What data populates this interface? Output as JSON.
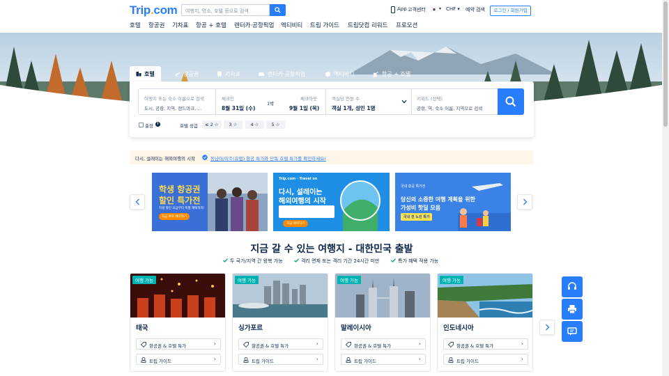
{
  "header": {
    "logo_main": "Trip",
    "logo_dot": ".",
    "logo_suffix": "com",
    "search_placeholder": "여행지, 명소, 호텔 등으로 검색",
    "app_label": "App",
    "support_label": "고객센터",
    "currency_label": "CHF",
    "booking_label": "예약 검색",
    "login_label": "로그인 / 회원가입"
  },
  "nav": [
    "호텔",
    "항공권",
    "기차표",
    "항공 + 호텔",
    "렌터카·공항픽업",
    "액티비티",
    "트립 가이드",
    "트립닷컴 리워드",
    "프로모션"
  ],
  "tabs": [
    {
      "label": "호텔",
      "icon": "hotel-icon",
      "active": true
    },
    {
      "label": "항공권",
      "icon": "airplane-icon"
    },
    {
      "label": "기차표",
      "icon": "train-icon"
    },
    {
      "label": "렌터카·공항픽업",
      "icon": "car-icon"
    },
    {
      "label": "액티비티",
      "icon": "activity-icon"
    },
    {
      "label": "항공 + 호텔",
      "icon": "bundle-icon"
    }
  ],
  "search_form": {
    "destination_label": "여행지 또는 숙소 이름으로 검색",
    "destination_hint": "도시, 공항, 지역, 랜드마크, ...",
    "checkin_label": "체크인",
    "checkin_value": "8월 31일 (수)",
    "nights": "1박",
    "checkout_label": "체크아웃",
    "checkout_value": "9월 1일 (목)",
    "guests_label": "객실당 인원 수",
    "guests_value": "객실 1개, 성인 1명",
    "keyword_label": "키워드 (선택)",
    "keyword_hint": "공항, 역, 숙소 이름, 지역으로 검색",
    "business_label": "출장",
    "star_label": "호텔 성급",
    "star_options": [
      "≤ 2 ☆",
      "3 ☆",
      "4 ☆",
      "5 ☆"
    ]
  },
  "promo": {
    "text": "다시, 설레이는 해외여행의 시작",
    "link": "동남아/미주(유럽) 항공 특가와 단독 호텔 특가를 확인하세요!"
  },
  "banners": [
    {
      "title_1": "학생 항공권",
      "title_2": "할인 특가전",
      "desc": "학생 할인 요금부터 특별 혜택까지!",
      "button": "지금 바로 예약하기"
    },
    {
      "brand": "Trip.com · Travel on",
      "title_1": "다시, 설레이는",
      "title_2": "해외여행의 시작",
      "button": "지금 예약하기"
    },
    {
      "tag": "국내 항공 특가전",
      "title_1": "당신의 소중한 여행 계획을 위한",
      "title_2": "가성비 핫딜 모음",
      "button": "국내 전 노선 특가"
    }
  ],
  "destinations": {
    "title": "지금 갈 수 있는 여행지 - 대한민국 출발",
    "features": [
      "두 국가/지역 간 왕복 가능",
      "격리 면제 또는 격리 기간 24시간 미만",
      "특가 혜택 적용 가능"
    ],
    "badge": "여행 가능",
    "cards": [
      {
        "name": "태국",
        "link1": "항공권 & 호텔 특가",
        "link2": "트립 가이드"
      },
      {
        "name": "싱가포르",
        "link1": "항공권 & 호텔 특가",
        "link2": "트립 가이드"
      },
      {
        "name": "말레이시아",
        "link1": "항공권 & 호텔 특가",
        "link2": "트립 가이드"
      },
      {
        "name": "인도네시아",
        "link1": "항공권 & 호텔 특가",
        "link2": "트립 가이드"
      }
    ]
  },
  "colors": {
    "brand": "#287dfa",
    "badge": "#00b3b3",
    "text": "#0f294d"
  }
}
